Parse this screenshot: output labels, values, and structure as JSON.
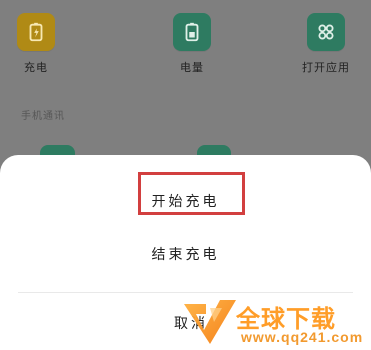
{
  "apps": [
    {
      "label": "充电",
      "icon": "battery-charging-icon",
      "color": "#b08a15"
    },
    {
      "label": "电量",
      "icon": "battery-level-icon",
      "color": "#2e7b61"
    },
    {
      "label": "打开应用",
      "icon": "open-apps-icon",
      "color": "#2e7b61"
    }
  ],
  "section": {
    "title": "手机通讯"
  },
  "sheet": {
    "start_charging": "开始充电",
    "stop_charging": "结束充电",
    "cancel": "取消"
  },
  "watermark": {
    "title": "全球下载",
    "url": "www.qq241.com"
  },
  "colors": {
    "highlight": "#d23f3f",
    "accent_green": "#2e7b61",
    "accent_yellow": "#b08a15",
    "watermark_orange": "#ff9d28"
  }
}
